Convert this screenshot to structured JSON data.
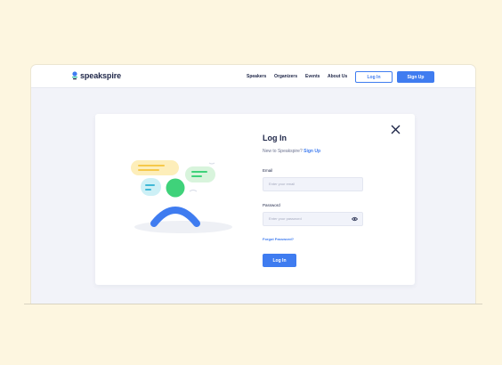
{
  "brand": {
    "name": "speakspire"
  },
  "nav": {
    "links": [
      "Speakers",
      "Organizers",
      "Events",
      "About Us"
    ],
    "login_label": "Log In",
    "signup_label": "Sign Up"
  },
  "login": {
    "title": "Log In",
    "subtitle_prefix": "New to Speakspire?",
    "subtitle_link": "Sign Up",
    "email_label": "Email",
    "email_placeholder": "Enter your email",
    "password_label": "Password",
    "password_placeholder": "Enter your password",
    "forgot_label": "Forgot Password?",
    "submit_label": "Log In"
  },
  "colors": {
    "background": "#fdf6e0",
    "accent": "#3f7cf0",
    "text": "#1d2547",
    "surface": "#f2f3f9"
  },
  "icons": [
    "logo-microphone-icon",
    "close-icon",
    "eye-icon"
  ]
}
